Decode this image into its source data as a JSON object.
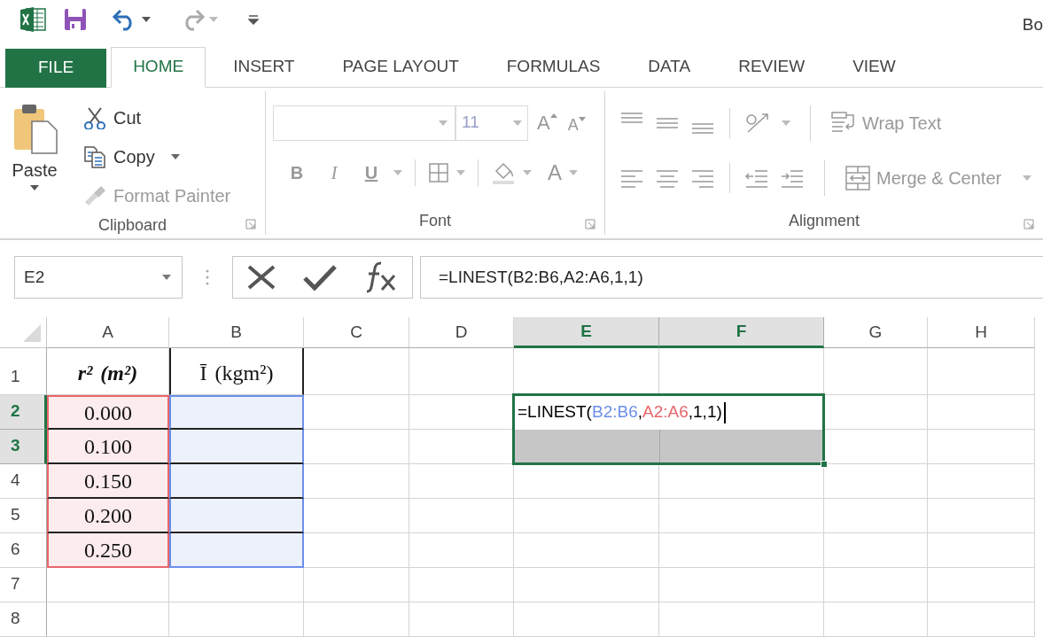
{
  "window": {
    "title": "Bo"
  },
  "tabs": [
    {
      "label": "FILE",
      "kind": "file",
      "selected": false
    },
    {
      "label": "HOME",
      "kind": "tab",
      "selected": true
    },
    {
      "label": "INSERT",
      "kind": "tab",
      "selected": false
    },
    {
      "label": "PAGE LAYOUT",
      "kind": "tab",
      "selected": false
    },
    {
      "label": "FORMULAS",
      "kind": "tab",
      "selected": false
    },
    {
      "label": "DATA",
      "kind": "tab",
      "selected": false
    },
    {
      "label": "REVIEW",
      "kind": "tab",
      "selected": false
    },
    {
      "label": "VIEW",
      "kind": "tab",
      "selected": false
    }
  ],
  "ribbon": {
    "clipboard": {
      "label": "Clipboard",
      "paste": "Paste",
      "items": [
        {
          "label": "Cut",
          "kind": "cut",
          "disabled": false
        },
        {
          "label": "Copy",
          "kind": "copy",
          "disabled": false
        },
        {
          "label": "Format Painter",
          "kind": "painter",
          "disabled": true
        }
      ]
    },
    "font": {
      "label": "Font",
      "size": "11",
      "grow": "A",
      "shrink": "A",
      "format_buttons": [
        {
          "label": "B",
          "kind": "bold"
        },
        {
          "label": "I",
          "kind": "italic"
        },
        {
          "label": "U",
          "kind": "underline"
        }
      ],
      "font_color": "A"
    },
    "alignment": {
      "label": "Alignment",
      "wrap": "Wrap Text",
      "merge": "Merge & Center"
    }
  },
  "formula_bar": {
    "name_box": "E2",
    "formula": "=LINEST(B2:B6,A2:A6,1,1)"
  },
  "sheet": {
    "columns": [
      {
        "label": "A",
        "selected": false
      },
      {
        "label": "B",
        "selected": false
      },
      {
        "label": "C",
        "selected": false
      },
      {
        "label": "D",
        "selected": false
      },
      {
        "label": "E",
        "selected": true
      },
      {
        "label": "F",
        "selected": true
      },
      {
        "label": "G",
        "selected": false
      },
      {
        "label": "H",
        "selected": false
      }
    ],
    "rows": [
      {
        "label": "1",
        "selected": false,
        "cells": [
          {
            "text": "r² (m²)",
            "kind": "header_bold"
          },
          {
            "text": "Ī (kgm²)",
            "kind": "header",
            "side_borders": true
          }
        ]
      },
      {
        "label": "2",
        "selected": true,
        "cells": [
          {
            "text": "0.000",
            "bottom_border": true,
            "color": "#e8656a"
          },
          {
            "bottom_border": true,
            "color": "#6b8fea"
          }
        ]
      },
      {
        "label": "3",
        "selected": true,
        "cells": [
          {
            "text": "0.100",
            "bottom_border": true,
            "color": "#e8656a"
          },
          {
            "bottom_border": true,
            "color": "#6b8fea"
          }
        ]
      },
      {
        "label": "4",
        "selected": false,
        "cells": [
          {
            "text": "0.150",
            "bottom_border": true,
            "color": "#e8656a"
          },
          {
            "bottom_border": true,
            "color": "#6b8fea"
          }
        ]
      },
      {
        "label": "5",
        "selected": false,
        "cells": [
          {
            "text": "0.200",
            "bottom_border": true,
            "color": "#e8656a"
          },
          {
            "bottom_border": true,
            "color": "#6b8fea"
          }
        ]
      },
      {
        "label": "6",
        "selected": false,
        "cells": [
          {
            "text": "0.250",
            "color": "#e8656a"
          },
          {
            "color": "#6b8fea"
          }
        ]
      },
      {
        "label": "7",
        "selected": false,
        "cells": []
      },
      {
        "label": "8",
        "selected": false,
        "cells": []
      }
    ],
    "editor": [
      {
        "text": "=LINEST("
      },
      {
        "text": "B2:B6",
        "color": "#6b8fea"
      },
      {
        "text": ","
      },
      {
        "text": "A2:A6",
        "color": "#e8656a"
      },
      {
        "text": ",1,1)"
      }
    ]
  }
}
